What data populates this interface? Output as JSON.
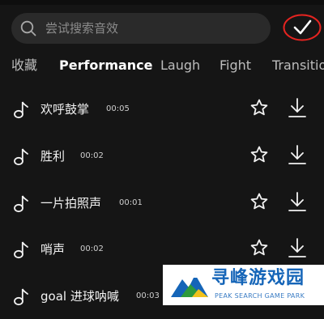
{
  "search": {
    "placeholder": "尝试搜索音效"
  },
  "tabs": [
    {
      "label": "收藏",
      "active": false
    },
    {
      "label": "Performance",
      "active": true
    },
    {
      "label": "Laugh",
      "active": false
    },
    {
      "label": "Fight",
      "active": false
    },
    {
      "label": "Transition",
      "active": false
    }
  ],
  "sounds": [
    {
      "name": "欢呼鼓掌",
      "duration": "00:05"
    },
    {
      "name": "胜利",
      "duration": "00:02"
    },
    {
      "name": "一片拍照声",
      "duration": "00:01"
    },
    {
      "name": "哨声",
      "duration": "00:02"
    },
    {
      "name": "goal 进球呐喊",
      "duration": "00:03"
    }
  ],
  "watermark": {
    "title": "寻峰游戏园",
    "subtitle": "PEAK SEARCH GAME PARK"
  },
  "colors": {
    "background": "#151515",
    "search_bg": "#2a2a2a",
    "highlight_ring": "#e52420",
    "watermark_blue": "#1565b8"
  },
  "icons": {
    "search": "search-icon",
    "confirm": "checkmark-icon",
    "note": "music-note-icon",
    "favorite": "star-outline-icon",
    "download": "download-icon"
  }
}
